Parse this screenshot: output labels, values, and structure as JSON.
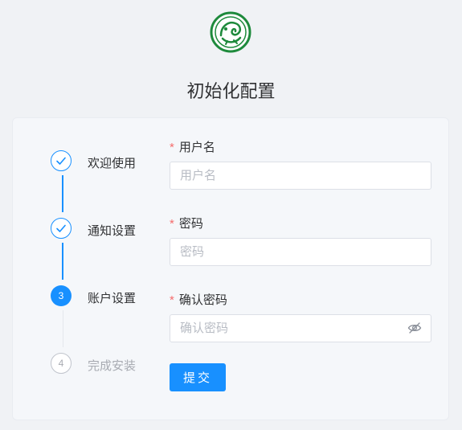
{
  "page": {
    "title": "初始化配置"
  },
  "steps": [
    {
      "number": "1",
      "label": "欢迎使用",
      "status": "done"
    },
    {
      "number": "2",
      "label": "通知设置",
      "status": "done"
    },
    {
      "number": "3",
      "label": "账户设置",
      "status": "active"
    },
    {
      "number": "4",
      "label": "完成安装",
      "status": "wait"
    }
  ],
  "form": {
    "required_mark": "*",
    "username": {
      "label": "用户名",
      "placeholder": "用户名",
      "value": ""
    },
    "password": {
      "label": "密码",
      "placeholder": "密码",
      "value": ""
    },
    "confirm_password": {
      "label": "确认密码",
      "placeholder": "确认密码",
      "value": "",
      "toggle_icon": "eye-off-icon"
    },
    "submit_label": "提交"
  },
  "colors": {
    "primary": "#1890ff",
    "required": "#f56c6c",
    "logo_green": "#1e8a3c",
    "background": "#f0f2f5"
  }
}
